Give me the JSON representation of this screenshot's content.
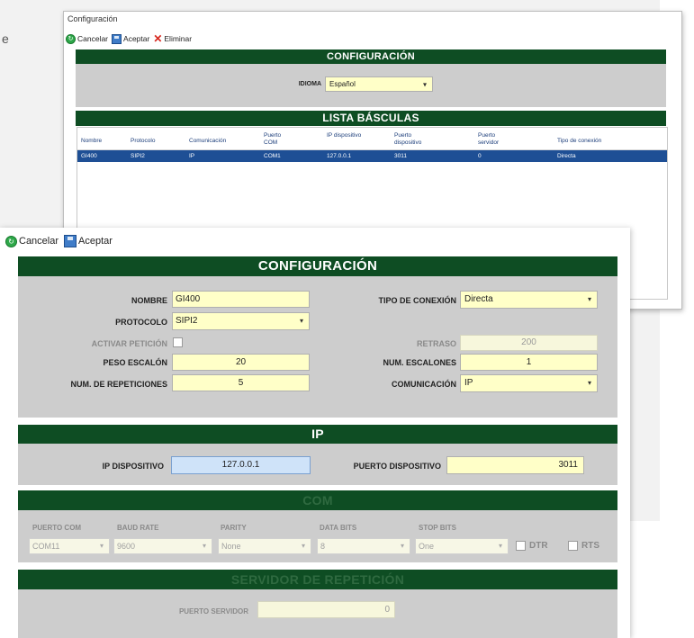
{
  "stray_text": "e",
  "back_window": {
    "title": "Configuración",
    "toolbar": {
      "cancel": "Cancelar",
      "accept": "Aceptar",
      "delete": "Eliminar"
    },
    "config_header": "CONFIGURACIÓN",
    "language_label": "IDIOMA",
    "language_value": "Español",
    "list_header": "LISTA BÁSCULAS",
    "columns": [
      "Nombre",
      "Protocolo",
      "Comunicación",
      "Puerto COM",
      "IP dispositivo",
      "Puerto dispositivo",
      "Puerto servidor",
      "Tipo de conexión"
    ],
    "rows": [
      [
        "GI400",
        "SIPI2",
        "IP",
        "COM1",
        "127.0.0.1",
        "3011",
        "0",
        "Directa"
      ]
    ]
  },
  "front_window": {
    "toolbar": {
      "cancel": "Cancelar",
      "accept": "Aceptar"
    },
    "config": {
      "header": "CONFIGURACIÓN",
      "nombre_label": "NOMBRE",
      "nombre_value": "GI400",
      "protocolo_label": "PROTOCOLO",
      "protocolo_value": "SIPI2",
      "activar_label": "ACTIVAR PETICIÓN",
      "peso_label": "PESO ESCALÓN",
      "peso_value": "20",
      "repeticiones_label": "NUM. DE REPETICIONES",
      "repeticiones_value": "5",
      "tipo_label": "TIPO DE CONEXIÓN",
      "tipo_value": "Directa",
      "retraso_label": "RETRASO",
      "retraso_value": "200",
      "escalones_label": "NUM. ESCALONES",
      "escalones_value": "1",
      "comunicacion_label": "COMUNICACIÓN",
      "comunicacion_value": "IP"
    },
    "ip": {
      "header": "IP",
      "ip_label": "IP DISPOSITIVO",
      "ip_value": "127.0.0.1",
      "puerto_label": "PUERTO DISPOSITIVO",
      "puerto_value": "3011"
    },
    "com": {
      "header": "COM",
      "puerto_label": "PUERTO COM",
      "puerto_value": "COM11",
      "baud_label": "BAUD RATE",
      "baud_value": "9600",
      "parity_label": "PARITY",
      "parity_value": "None",
      "databits_label": "DATA BITS",
      "databits_value": "8",
      "stopbits_label": "STOP BITS",
      "stopbits_value": "One",
      "dtr_label": "DTR",
      "rts_label": "RTS"
    },
    "servidor": {
      "header": "SERVIDOR DE REPETICIÓN",
      "puerto_label": "PUERTO SERVIDOR",
      "puerto_value": "0"
    }
  },
  "colors": {
    "header_green": "#0e4d23",
    "field_yellow": "#ffffc8",
    "field_blue": "#cfe3f9",
    "selected_row": "#1e4f95",
    "section_gray": "#cdcdcd"
  }
}
